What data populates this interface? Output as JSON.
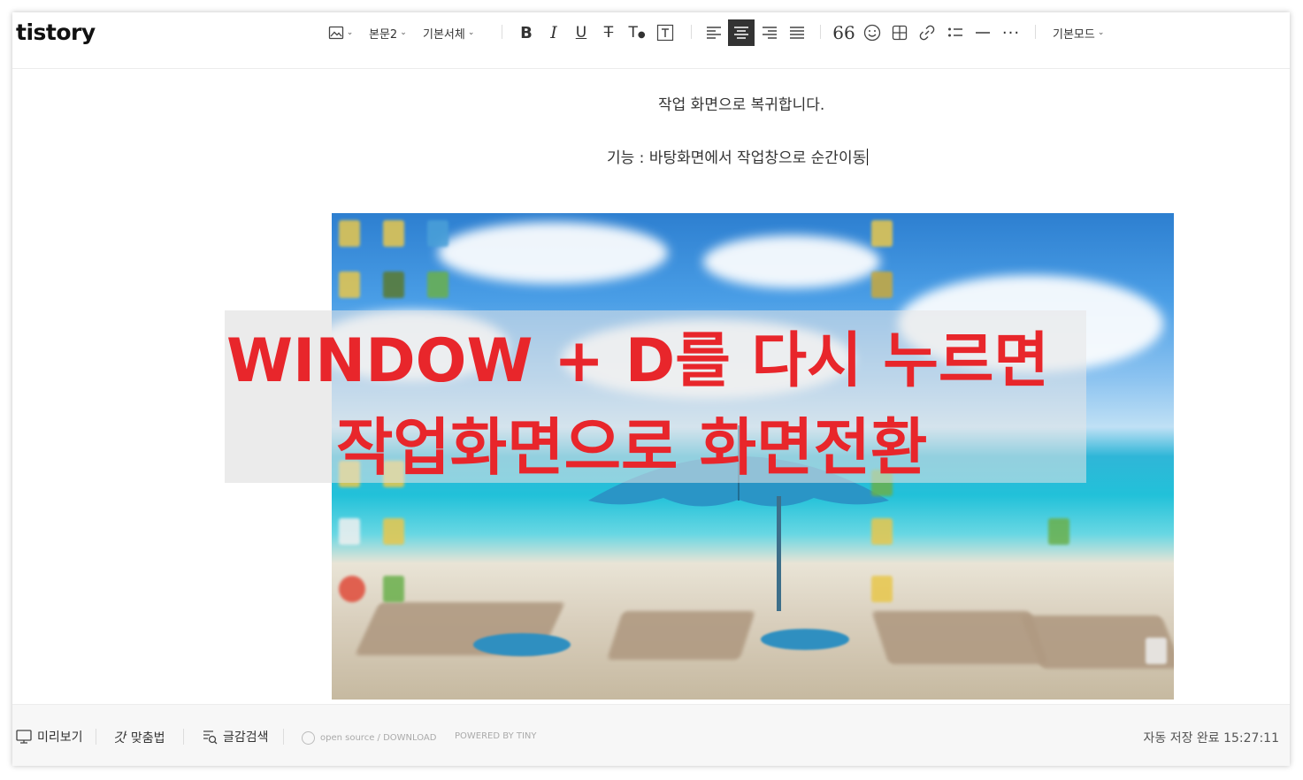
{
  "app": {
    "logo": "tistory"
  },
  "toolbar": {
    "paragraph_style": "본문2",
    "font_family": "기본서체",
    "mode": "기본모드",
    "icons": [
      "image-icon",
      "bold-icon",
      "italic-icon",
      "underline-icon",
      "strikethrough-icon",
      "text-color-icon",
      "text-background-icon",
      "align-left-icon",
      "align-center-icon",
      "align-right-icon",
      "align-justify-icon",
      "quote-icon",
      "emoji-icon",
      "table-icon",
      "link-icon",
      "list-icon",
      "divider-icon",
      "more-icon"
    ],
    "active_icon": "align-center-icon"
  },
  "content": {
    "line_1": "작업 화면으로 복귀합니다.",
    "line_2": "기능 : 바탕화면에서 작업창으로 순간이동",
    "overlay_line_1": "WINDOW + D를 다시 누르면",
    "overlay_line_2": "작업화면으로 화면전환"
  },
  "footer": {
    "preview": "미리보기",
    "spellcheck": "맞춤법",
    "search": "글감검색",
    "open_source": "open source / DOWNLOAD",
    "powered": "POWERED BY TINY",
    "autosave": "자동 저장 완료 15:27:11"
  },
  "colors": {
    "accent_red": "#e8262b",
    "active_bg": "#333333"
  }
}
